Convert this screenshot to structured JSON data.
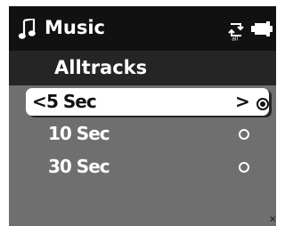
{
  "status": {
    "app_name": "Music",
    "music_icon": "music-note-icon",
    "repeat_icon": "repeat-all-icon",
    "repeat_icon_text": "all",
    "battery_icon": "battery-icon"
  },
  "screen": {
    "title": "Alltracks"
  },
  "options": [
    {
      "label": "5 Sec",
      "selected": true
    },
    {
      "label": "10 Sec",
      "selected": false
    },
    {
      "label": "30 Sec",
      "selected": false
    }
  ],
  "navigation": {
    "left_symbol": "<",
    "right_symbol": ">"
  },
  "colors": {
    "status_bar": "#111111",
    "title_bar": "#252525",
    "list_background": "#6f6f6f",
    "selection_background": "#ffffff",
    "text_light": "#ffffff",
    "text_dark": "#111111"
  }
}
